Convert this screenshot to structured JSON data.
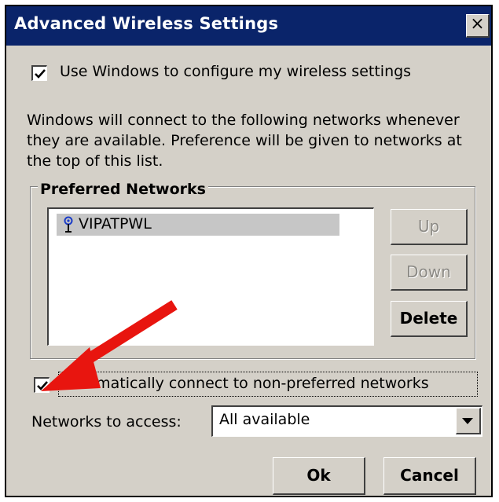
{
  "dialog": {
    "title": "Advanced Wireless Settings",
    "close_label": "×"
  },
  "use_windows_checkbox": {
    "label": "Use Windows to configure my wireless settings",
    "checked": true
  },
  "description": "Windows will connect to the following networks whenever they are available.  Preference will be given to networks at the top of this list.",
  "preferred_networks": {
    "group_label": "Preferred Networks",
    "items": [
      {
        "label": "VIPATPWL",
        "icon": "wireless-antenna-icon"
      }
    ],
    "buttons": {
      "up": "Up",
      "down": "Down",
      "delete": "Delete"
    }
  },
  "auto_connect_checkbox": {
    "label": "Automatically connect to non-preferred networks",
    "checked": true
  },
  "networks_to_access": {
    "label": "Networks to access:",
    "value": "All available"
  },
  "footer": {
    "ok": "Ok",
    "cancel": "Cancel"
  },
  "colors": {
    "titlebar": "#0a246a",
    "dialog_bg": "#d4d0c8",
    "annotation_arrow": "#e8150f"
  }
}
